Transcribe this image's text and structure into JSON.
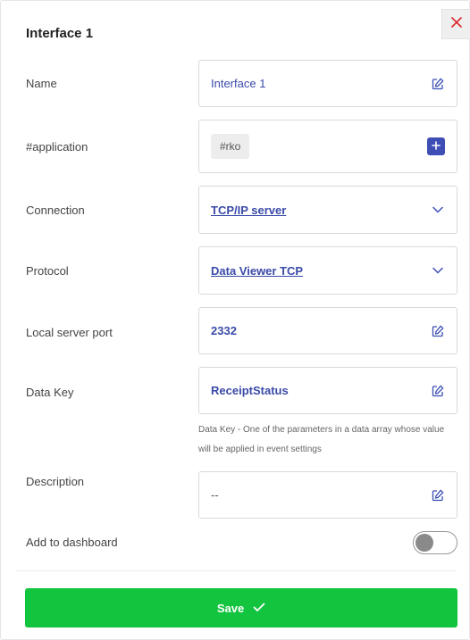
{
  "dialog": {
    "title": "Interface 1"
  },
  "fields": {
    "name": {
      "label": "Name",
      "value": "Interface 1"
    },
    "application": {
      "label": "#application",
      "tag": "#rko"
    },
    "connection": {
      "label": "Connection",
      "value": "TCP/IP server"
    },
    "protocol": {
      "label": "Protocol",
      "value": "Data Viewer TCP"
    },
    "port": {
      "label": "Local server port",
      "value": "2332"
    },
    "data_key": {
      "label": "Data Key",
      "value": "ReceiptStatus",
      "hint": "Data Key - One of the parameters in a data array whose value will be applied in event settings"
    },
    "description": {
      "label": "Description",
      "value": "--"
    },
    "dashboard": {
      "label": "Add to dashboard",
      "enabled": false
    }
  },
  "footer": {
    "save_label": "Save"
  },
  "colors": {
    "accent": "#3d4fb5",
    "save": "#13c43f",
    "close": "#d9262c",
    "link": "#3a4aa8"
  },
  "icons": [
    "close-icon",
    "edit-icon",
    "plus-icon",
    "chevron-down-icon",
    "check-icon"
  ]
}
